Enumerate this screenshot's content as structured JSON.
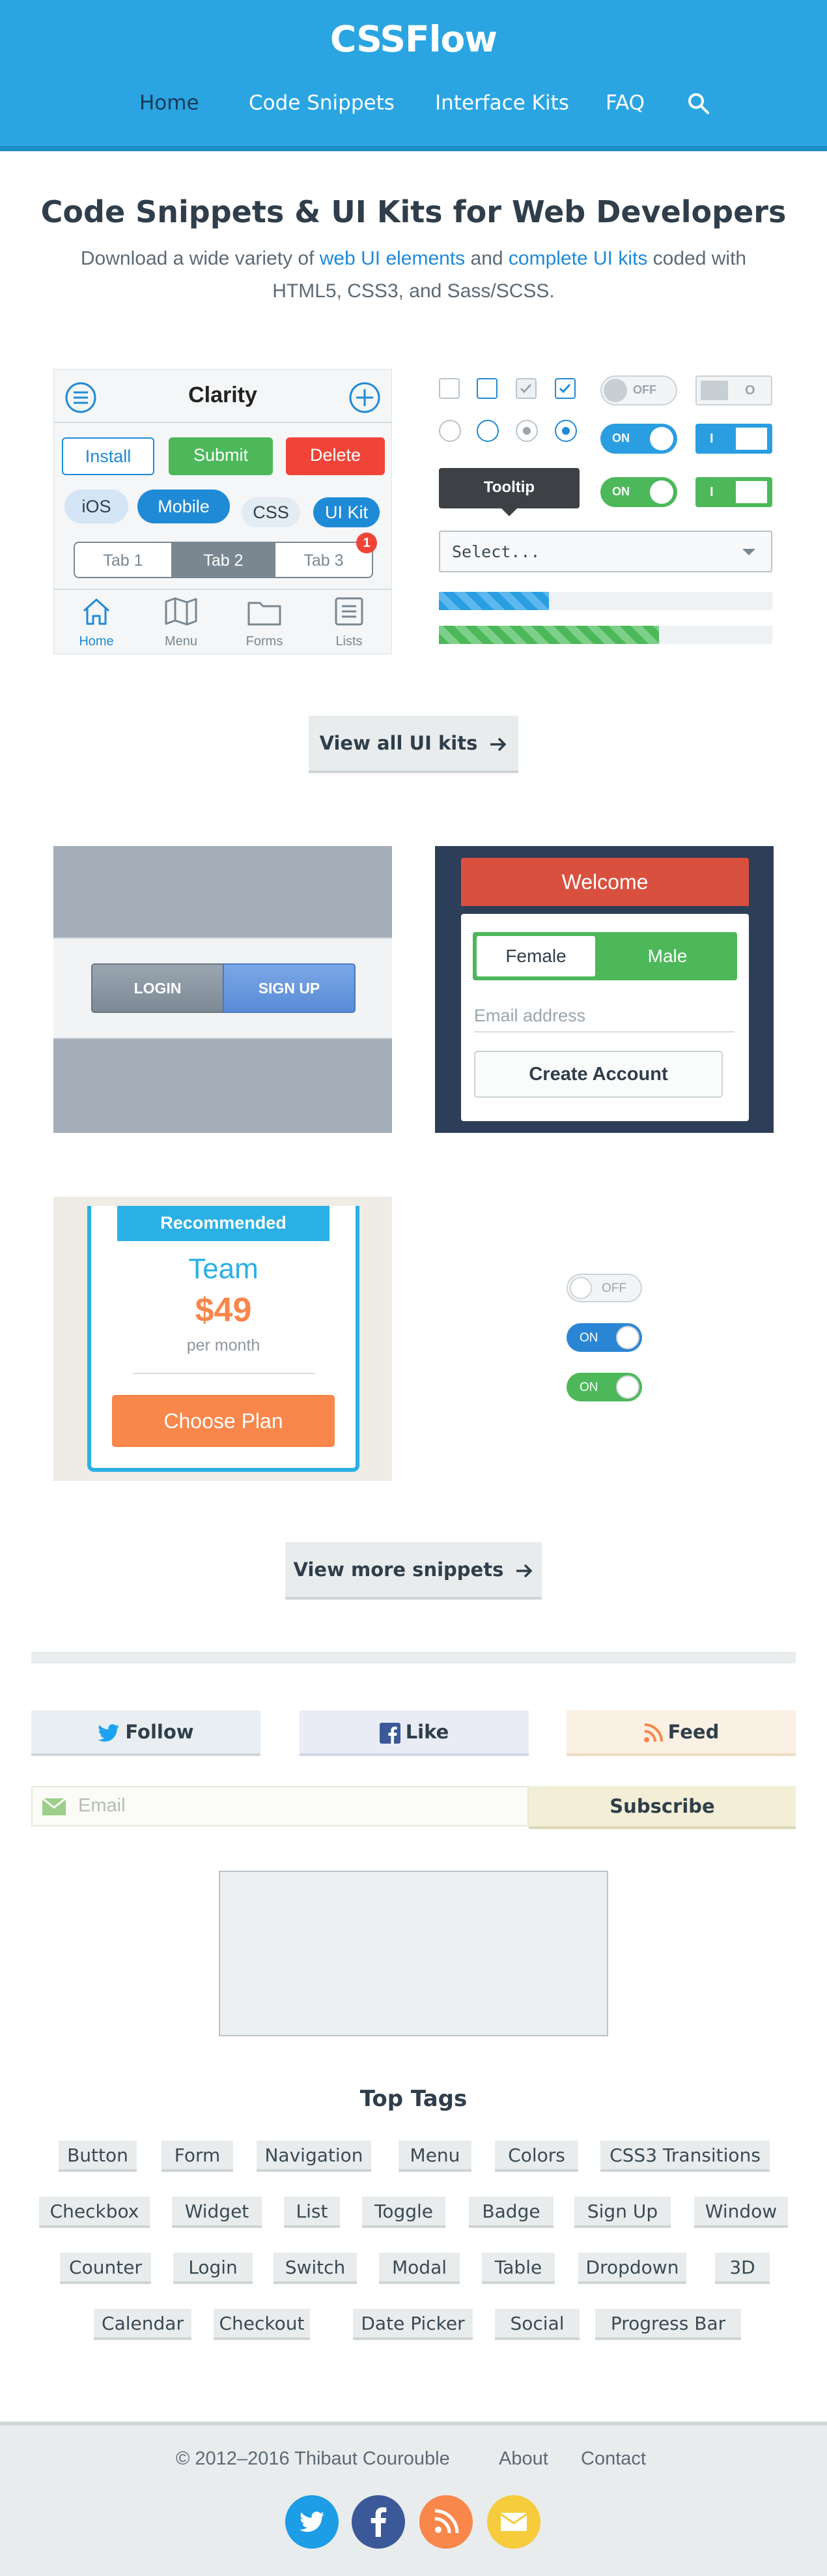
{
  "header": {
    "logo": "CSSFlow",
    "nav": [
      "Home",
      "Code Snippets",
      "Interface Kits",
      "FAQ"
    ],
    "search_icon": "search-icon"
  },
  "hero": {
    "title": "Code Snippets & UI Kits for Web Developers",
    "sub_1": "Download a wide variety of ",
    "link_1": "web UI elements",
    "sub_2": " and ",
    "link_2": "complete UI kits",
    "sub_3": " coded with HTML5, CSS3, and Sass/SCSS."
  },
  "mobile_kit": {
    "title": "Clarity",
    "buttons": [
      "Install",
      "Submit",
      "Delete"
    ],
    "pills": [
      "iOS",
      "Mobile",
      "CSS",
      "UI Kit"
    ],
    "segments": [
      "Tab 1",
      "Tab 2",
      "Tab 3"
    ],
    "badge": "1",
    "tabbar": [
      "Home",
      "Menu",
      "Forms",
      "Lists"
    ]
  },
  "widgets_kit": {
    "toggle_off": "OFF",
    "toggle_on": "ON",
    "square_off": "O",
    "square_on": "I",
    "tooltip": "Tooltip",
    "select": "Select...",
    "progress_blue": 0.33,
    "progress_green": 0.66
  },
  "view_all_kits": "View all UI kits",
  "snippets": {
    "login": "LOGIN",
    "signup": "SIGN UP",
    "welcome": "Welcome",
    "female": "Female",
    "male": "Male",
    "email_placeholder": "Email address",
    "create_account": "Create Account",
    "ribbon": "Recommended",
    "plan": "Team",
    "price": "$49",
    "period": "per month",
    "choose": "Choose Plan",
    "switch_off": "OFF",
    "switch_on": "ON"
  },
  "view_more": "View more snippets",
  "social": {
    "follow": "Follow",
    "like": "Like",
    "feed": "Feed",
    "email_placeholder": "Email",
    "subscribe": "Subscribe"
  },
  "tags": {
    "title": "Top Tags",
    "rows": [
      [
        "Button",
        "Form",
        "Navigation",
        "Menu",
        "Colors",
        "CSS3 Transitions"
      ],
      [
        "Checkbox",
        "Widget",
        "List",
        "Toggle",
        "Badge",
        "Sign Up",
        "Window"
      ],
      [
        "Counter",
        "Login",
        "Switch",
        "Modal",
        "Table",
        "Dropdown",
        "3D"
      ],
      [
        "Calendar",
        "Checkout",
        "Date Picker",
        "Social",
        "Progress Bar"
      ]
    ]
  },
  "footer": {
    "copyright": "© 2012–2016 Thibaut Courouble",
    "about": "About",
    "contact": "Contact"
  },
  "colors": {
    "brand": "#2aa5e2",
    "green": "#4cb85a",
    "red": "#f04438",
    "orange": "#f9864a"
  }
}
